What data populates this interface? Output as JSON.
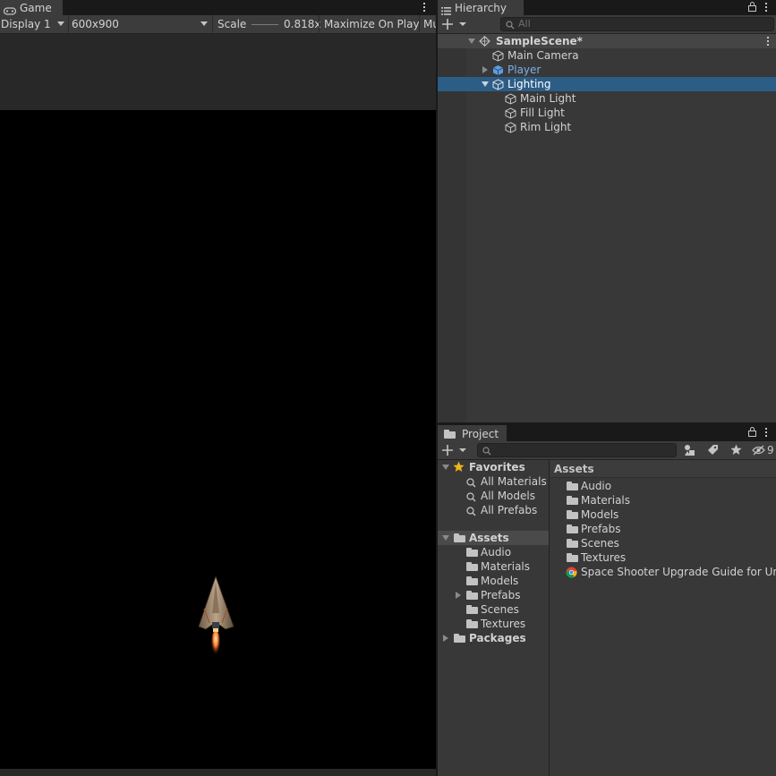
{
  "colors": {
    "panel": "#383838",
    "toolbar": "#3c3c3c",
    "selection": "#2c5d87",
    "prefab_text": "#7bafe9",
    "game_view": "#000000"
  },
  "game": {
    "tab_label": "Game",
    "tab_icon": "gamepad-icon",
    "display_label": "Display 1",
    "resolution_label": "600x900",
    "scale_label": "Scale",
    "scale_value": "0.818x",
    "maximize_label": "Maximize On Play",
    "overflow_label": "Mu"
  },
  "hierarchy": {
    "tab_label": "Hierarchy",
    "search_placeholder": "All",
    "scene_name": "SampleScene*",
    "items": [
      {
        "label": "Main Camera"
      },
      {
        "label": "Player"
      },
      {
        "label": "Lighting"
      },
      {
        "label": "Main Light"
      },
      {
        "label": "Fill Light"
      },
      {
        "label": "Rim Light"
      }
    ]
  },
  "project": {
    "tab_label": "Project",
    "hidden_count": "9",
    "favorites": {
      "label": "Favorites",
      "items": [
        "All Materials",
        "All Models",
        "All Prefabs"
      ]
    },
    "assets_tree": {
      "label": "Assets",
      "items": [
        "Audio",
        "Materials",
        "Models",
        "Prefabs",
        "Scenes",
        "Textures"
      ]
    },
    "packages_label": "Packages",
    "breadcrumb": "Assets",
    "content": {
      "folders": [
        "Audio",
        "Materials",
        "Models",
        "Prefabs",
        "Scenes",
        "Textures"
      ],
      "link_file": "Space Shooter Upgrade Guide for Unity"
    }
  }
}
